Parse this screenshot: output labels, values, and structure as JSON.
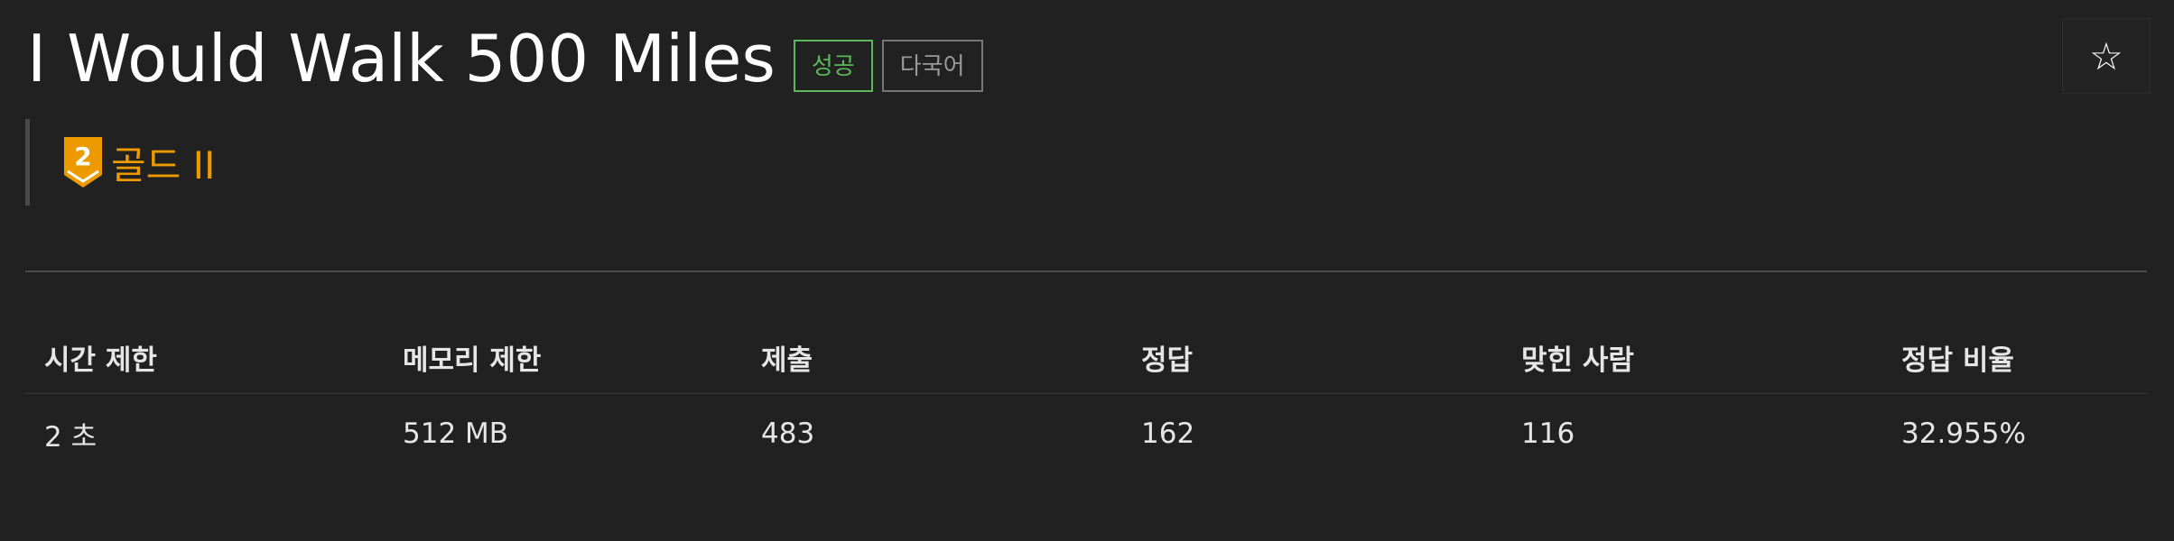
{
  "problem": {
    "title": "I Would Walk 500 Miles",
    "badges": {
      "success": "성공",
      "multilang": "다국어"
    },
    "tier": {
      "level": "2",
      "label": "골드 II",
      "color": "#ec9a00"
    }
  },
  "star_icon": "☆",
  "table": {
    "headers": [
      "시간 제한",
      "메모리 제한",
      "제출",
      "정답",
      "맞힌 사람",
      "정답 비율"
    ],
    "row": [
      "2 초",
      "512 MB",
      "483",
      "162",
      "116",
      "32.955%"
    ]
  },
  "colors": {
    "background": "#212121",
    "success": "#5cb85c",
    "tier_gold": "#ec9a00"
  }
}
